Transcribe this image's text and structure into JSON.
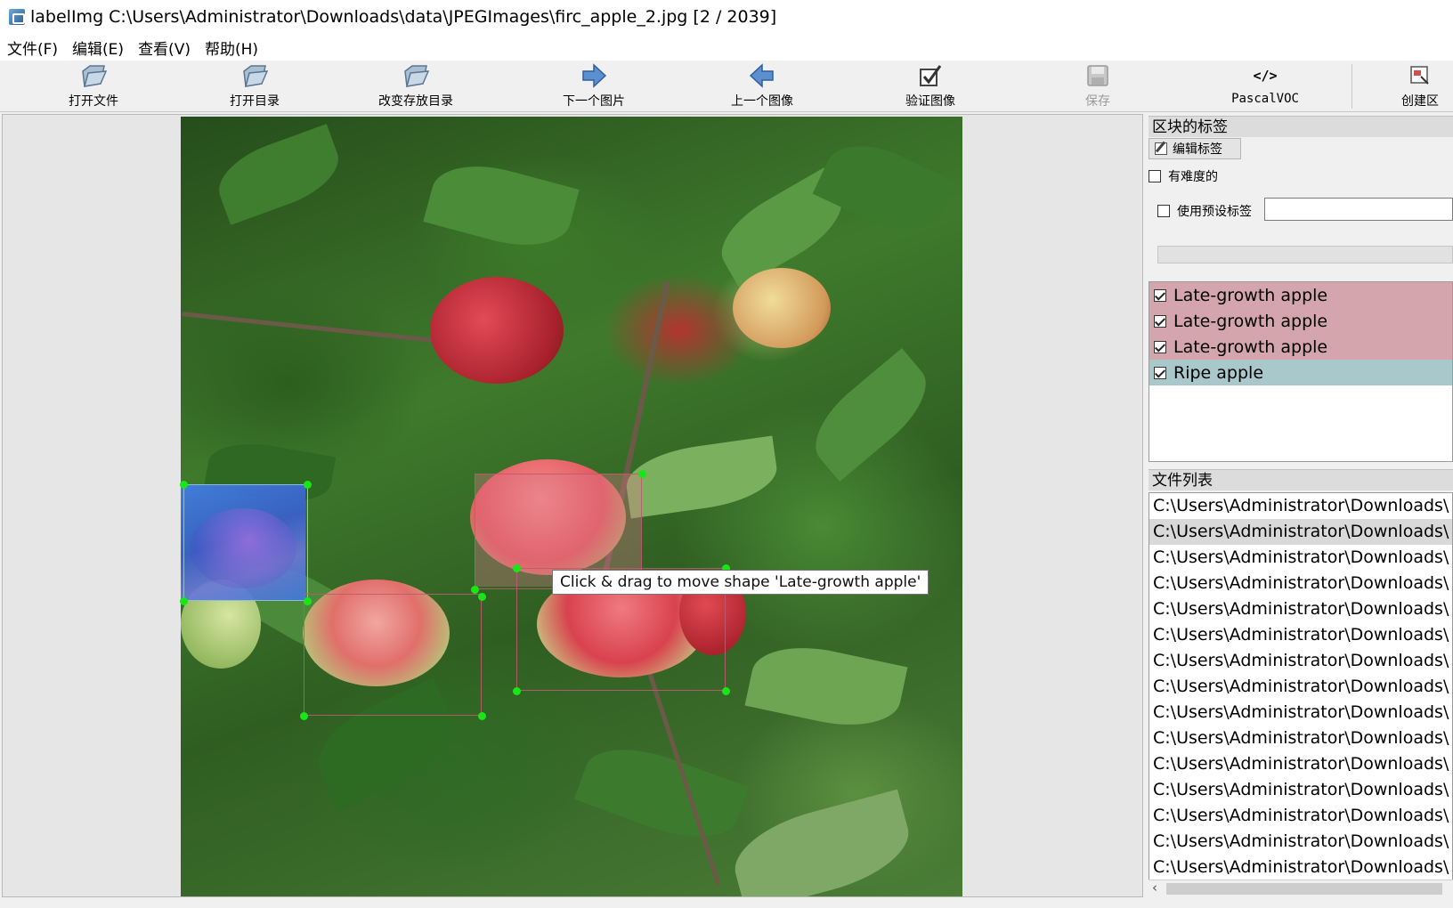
{
  "window": {
    "title": "labelImg C:\\Users\\Administrator\\Downloads\\data\\JPEGImages\\firc_apple_2.jpg [2 / 2039]"
  },
  "menu": [
    "文件(F)",
    "编辑(E)",
    "查看(V)",
    "帮助(H)"
  ],
  "toolbar": {
    "open_file": "打开文件",
    "open_dir": "打开目录",
    "change_save_dir": "改变存放目录",
    "next_image": "下一个图片",
    "prev_image": "上一个图像",
    "verify_image": "验证图像",
    "save": "保存",
    "format": "PascalVOC",
    "create_box": "创建区"
  },
  "box_labels_panel": {
    "title": "区块的标签",
    "edit_label_button": "编辑标签",
    "difficult_label": "有难度的",
    "use_default_label": "使用预设标签",
    "default_label_value": ""
  },
  "labels": [
    {
      "text": "Late-growth apple",
      "checked": true,
      "color": "#d4a5ad"
    },
    {
      "text": "Late-growth apple",
      "checked": true,
      "color": "#d4a5ad"
    },
    {
      "text": "Late-growth apple",
      "checked": true,
      "color": "#d4a5ad"
    },
    {
      "text": "Ripe apple",
      "checked": true,
      "color": "#a9c8cc"
    }
  ],
  "file_list_panel": {
    "title": "文件列表",
    "files": [
      "C:\\Users\\Administrator\\Downloads\\",
      "C:\\Users\\Administrator\\Downloads\\",
      "C:\\Users\\Administrator\\Downloads\\",
      "C:\\Users\\Administrator\\Downloads\\",
      "C:\\Users\\Administrator\\Downloads\\",
      "C:\\Users\\Administrator\\Downloads\\",
      "C:\\Users\\Administrator\\Downloads\\",
      "C:\\Users\\Administrator\\Downloads\\",
      "C:\\Users\\Administrator\\Downloads\\",
      "C:\\Users\\Administrator\\Downloads\\",
      "C:\\Users\\Administrator\\Downloads\\",
      "C:\\Users\\Administrator\\Downloads\\",
      "C:\\Users\\Administrator\\Downloads\\",
      "C:\\Users\\Administrator\\Downloads\\",
      "C:\\Users\\Administrator\\Downloads\\"
    ],
    "selected_index": 1
  },
  "tooltip": "Click & drag to move shape 'Late-growth apple'",
  "colors": {
    "handle": "#19e619",
    "late_growth_row": "#d4a5ad",
    "ripe_row": "#a9c8cc"
  }
}
